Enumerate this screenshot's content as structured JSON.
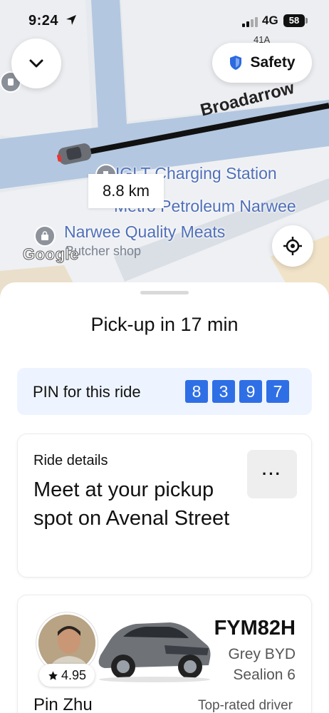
{
  "status_bar": {
    "time": "9:24",
    "network": "4G",
    "battery": "58"
  },
  "map": {
    "street_name": "Broadarrow",
    "street_number": "41A",
    "distance": "8.8 km",
    "pois": [
      {
        "name": "IGLT Charging Station"
      },
      {
        "name": "Metro Petroleum Narwee"
      },
      {
        "name": "Narwee Quality Meats",
        "category": "Butcher shop"
      }
    ],
    "attribution": "Google"
  },
  "buttons": {
    "safety_label": "Safety"
  },
  "sheet": {
    "pickup_title": "Pick-up in 17 min",
    "pin": {
      "label": "PIN for this ride",
      "digits": [
        "8",
        "3",
        "9",
        "7"
      ]
    },
    "ride_details": {
      "caption": "Ride details",
      "headline": "Meet at your pickup spot on Avenal Street",
      "more_label": "···"
    },
    "driver": {
      "name": "Pin Zhu",
      "rating": "4.95",
      "badge": "Top-rated driver",
      "plate": "FYM82H",
      "vehicle": "Grey BYD Sealion 6"
    }
  },
  "colors": {
    "pin_accent": "#2f6fe6",
    "pin_bg": "#eef4ff",
    "map_label": "#4f6fb8",
    "route": "#111111"
  }
}
